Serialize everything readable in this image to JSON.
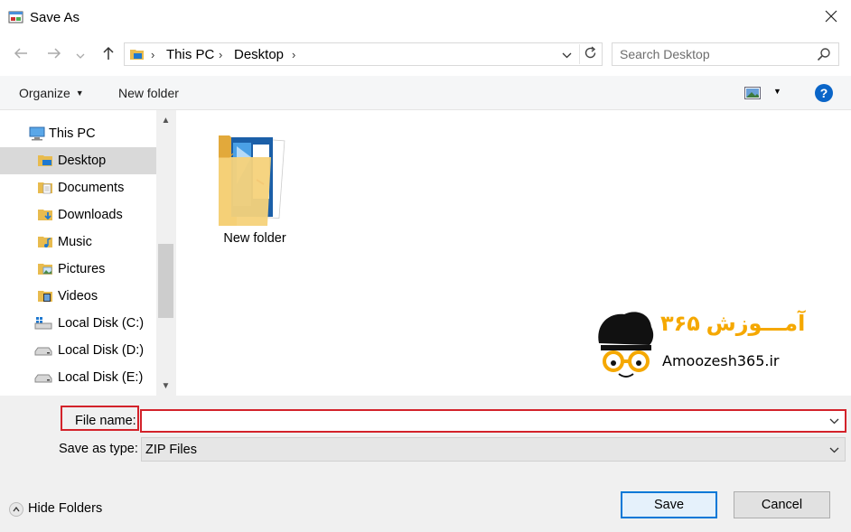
{
  "window": {
    "title": "Save As",
    "title_icon": "save-as-app-icon",
    "close_icon": "close-icon"
  },
  "nav": {
    "back_icon": "arrow-left-icon",
    "forward_icon": "arrow-right-icon",
    "recent_icon": "chevron-down-icon",
    "up_icon": "arrow-up-icon",
    "breadcrumbs": [
      "This PC",
      "Desktop"
    ],
    "search_placeholder": "Search Desktop"
  },
  "toolbar": {
    "organize_label": "Organize",
    "new_folder_label": "New folder",
    "help_label": "?"
  },
  "sidebar": {
    "items": [
      {
        "label": "This PC",
        "icon": "computer-icon",
        "selected": false
      },
      {
        "label": "Desktop",
        "icon": "desktop-folder-icon",
        "selected": true
      },
      {
        "label": "Documents",
        "icon": "documents-folder-icon",
        "selected": false
      },
      {
        "label": "Downloads",
        "icon": "downloads-folder-icon",
        "selected": false
      },
      {
        "label": "Music",
        "icon": "music-folder-icon",
        "selected": false
      },
      {
        "label": "Pictures",
        "icon": "pictures-folder-icon",
        "selected": false
      },
      {
        "label": "Videos",
        "icon": "videos-folder-icon",
        "selected": false
      },
      {
        "label": "Local Disk (C:)",
        "icon": "windows-drive-icon",
        "selected": false
      },
      {
        "label": "Local Disk (D:)",
        "icon": "drive-icon",
        "selected": false
      },
      {
        "label": "Local Disk (E:)",
        "icon": "drive-icon",
        "selected": false
      }
    ]
  },
  "content": {
    "files": [
      {
        "name": "New folder",
        "icon": "folder-icon"
      }
    ]
  },
  "watermark": {
    "farsi": "آمـــوزش ۳۶۵",
    "english": "Amoozesh365.ir"
  },
  "form": {
    "file_name_label": "File name:",
    "file_name_value": "",
    "save_type_label": "Save as type:",
    "save_type_value": "ZIP Files"
  },
  "footer": {
    "hide_folders_label": "Hide Folders",
    "save_label": "Save",
    "cancel_label": "Cancel"
  },
  "colors": {
    "highlight_red": "#d3222a",
    "selected_bg": "#d9d9d9",
    "accent_blue": "#0078d7",
    "logo_orange": "#f5a800"
  }
}
